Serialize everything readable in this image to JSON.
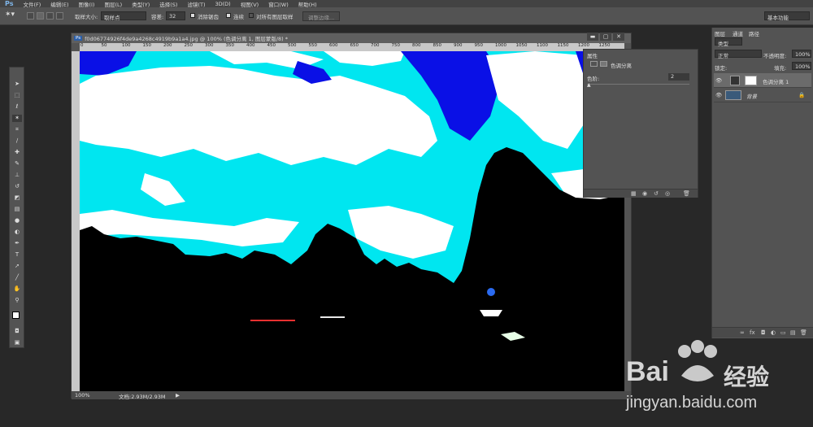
{
  "menu": {
    "logo": "Ps",
    "items": [
      "文件(F)",
      "编辑(E)",
      "图像(I)",
      "图层(L)",
      "类型(Y)",
      "选择(S)",
      "滤镜(T)",
      "3D(D)",
      "视图(V)",
      "窗口(W)",
      "帮助(H)"
    ]
  },
  "options": {
    "sample_size_label": "取样大小:",
    "sample_size_value": "取样点",
    "tolerance_label": "容差:",
    "tolerance_value": "32",
    "antialias_label": "消除锯齿",
    "contiguous_label": "连续",
    "all_layers_label": "对所有图层取样",
    "refine_edge_label": "调整边缘...",
    "workspace": "基本功能"
  },
  "document": {
    "badge": "Ps",
    "title": "f0d06774926f4de9a4268c4919b9a1a4.jpg @ 100% (色调分离 1, 图层蒙版/8) *",
    "ruler_marks": [
      "0",
      "50",
      "100",
      "150",
      "200",
      "250",
      "300",
      "350",
      "400",
      "450",
      "500",
      "550",
      "600",
      "650",
      "700",
      "750",
      "800",
      "850",
      "900",
      "950",
      "1000",
      "1050",
      "1100",
      "1150",
      "1200",
      "1250"
    ],
    "zoom": "100%",
    "doc_size": "文档:2.93M/2.93M"
  },
  "properties": {
    "tab": "属性",
    "adjustment_name": "色调分离",
    "levels_label": "色阶:",
    "levels_value": "2"
  },
  "layers": {
    "tabs": [
      "图层",
      "通道",
      "路径"
    ],
    "filter_kind": "类型",
    "blend_mode": "正常",
    "opacity_label": "不透明度:",
    "opacity_value": "100%",
    "lock_label": "锁定:",
    "fill_label": "填充:",
    "fill_value": "100%",
    "items": [
      {
        "name": "色调分离 1"
      },
      {
        "name": "背景"
      }
    ]
  },
  "watermark": {
    "brand_left": "Bai",
    "brand_right": "经验",
    "url": "jingyan.baidu.com"
  },
  "colors": {
    "ui_dark": "#282828",
    "panel": "#535353",
    "cyan": "#00e6f0",
    "blue": "#0a10e6",
    "white": "#ffffff",
    "black": "#000000"
  }
}
